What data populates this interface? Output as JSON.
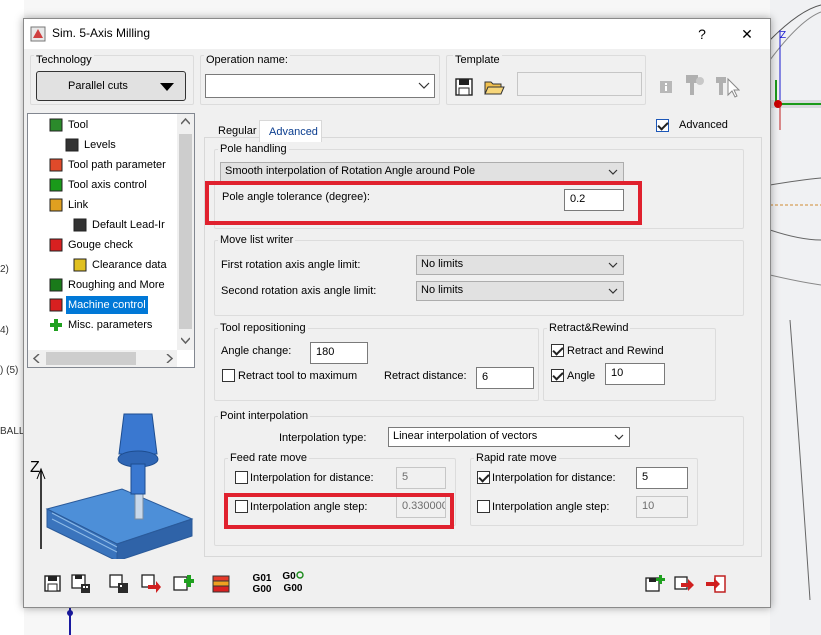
{
  "background": {
    "left_labels": [
      "2)",
      "4)",
      ") (5)",
      "BALL"
    ],
    "axis_label": "Z"
  },
  "dialog": {
    "title": "Sim. 5-Axis Milling",
    "help_label": "?",
    "close_label": "✕"
  },
  "technology": {
    "label": "Technology",
    "value": "Parallel cuts"
  },
  "operation": {
    "label": "Operation name:",
    "value": ""
  },
  "template": {
    "label": "Template",
    "value": ""
  },
  "tree": {
    "items": [
      {
        "label": "Tool",
        "icon": "tool-icon"
      },
      {
        "label": "Levels",
        "icon": "levels-icon"
      },
      {
        "label": "Tool path parameter",
        "icon": "toolpath-icon"
      },
      {
        "label": "Tool axis control",
        "icon": "axis-control-icon"
      },
      {
        "label": "Link",
        "icon": "link-icon"
      },
      {
        "label": "Default Lead-Ir",
        "icon": "lead-in-icon"
      },
      {
        "label": "Gouge check",
        "icon": "gouge-icon"
      },
      {
        "label": "Clearance data",
        "icon": "clearance-icon"
      },
      {
        "label": "Roughing and More",
        "icon": "roughing-icon"
      },
      {
        "label": "Machine control",
        "icon": "machine-control-icon",
        "selected": true
      },
      {
        "label": "Misc. parameters",
        "icon": "plus-icon"
      }
    ]
  },
  "preview": {
    "axis_label": "Z"
  },
  "tabs": {
    "regular": "Regular",
    "advanced": "Advanced",
    "advanced_checkbox_label": "Advanced",
    "advanced_checked": true
  },
  "pole_handling": {
    "title": "Pole handling",
    "mode": "Smooth interpolation of Rotation Angle around Pole",
    "tolerance_label": "Pole angle tolerance (degree):",
    "tolerance_value": "0.2"
  },
  "move_list_writer": {
    "title": "Move list writer",
    "first_label": "First rotation axis angle limit:",
    "first_value": "No limits",
    "second_label": "Second rotation axis angle limit:",
    "second_value": "No limits"
  },
  "tool_repositioning": {
    "title": "Tool repositioning",
    "angle_change_label": "Angle change:",
    "angle_change_value": "180",
    "retract_max_label": "Retract tool to maximum",
    "retract_max_checked": false,
    "retract_distance_label": "Retract distance:",
    "retract_distance_value": "6"
  },
  "retract_rewind": {
    "title": "Retract&Rewind",
    "enable_label": "Retract and Rewind",
    "enable_checked": true,
    "angle_label": "Angle",
    "angle_checked": true,
    "angle_value": "10"
  },
  "point_interpolation": {
    "title": "Point interpolation",
    "type_label": "Interpolation type:",
    "type_value": "Linear interpolation of vectors",
    "feed": {
      "title": "Feed rate move",
      "distance_label": "Interpolation for distance:",
      "distance_checked": false,
      "distance_value": "5",
      "angle_label": "Interpolation angle step:",
      "angle_checked": false,
      "angle_value": "0.330000"
    },
    "rapid": {
      "title": "Rapid rate move",
      "distance_label": "Interpolation for distance:",
      "distance_checked": true,
      "distance_value": "5",
      "angle_label": "Interpolation angle step:",
      "angle_checked": false,
      "angle_value": "10"
    }
  },
  "toolbar": {
    "g01_top": "G01",
    "g01_bottom": "G00",
    "g0_top": "G0",
    "g0_bottom": "G00"
  },
  "colors": {
    "highlight": "#e0212e",
    "selection": "#0078d7",
    "tab_active_text": "#0a3d8f"
  }
}
